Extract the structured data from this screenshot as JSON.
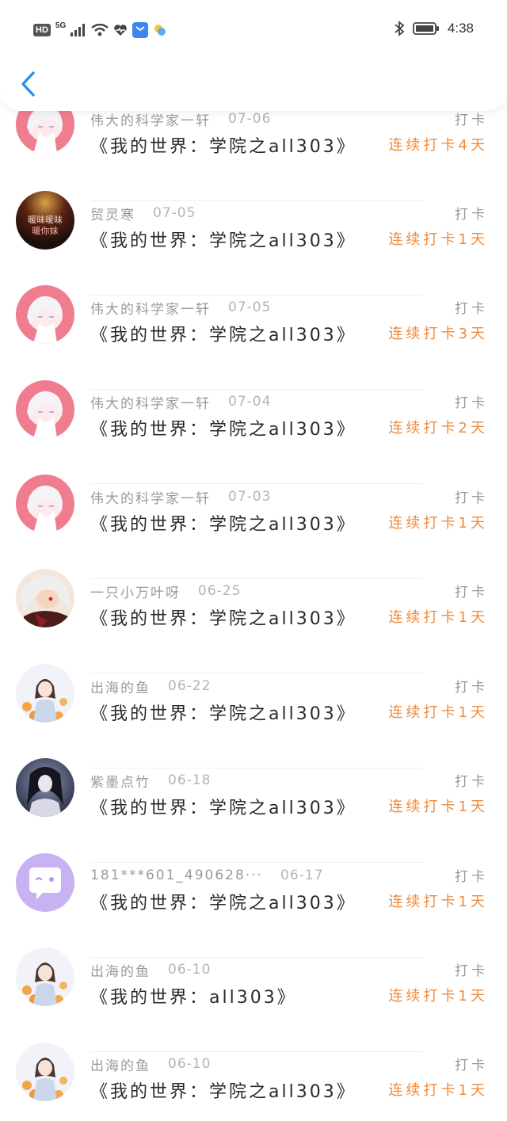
{
  "status_bar": {
    "hd": "HD",
    "network": "5G",
    "time": "4:38",
    "colors": {
      "mail": "#3d85f0"
    }
  },
  "nav": {
    "back_icon": "chevron-left-icon",
    "accent": "#2e8ef0"
  },
  "entries": [
    {
      "user": "伟大的科学家一轩",
      "date": "07-06",
      "title": "《我的世界：学院之all303》",
      "kind": "打卡",
      "streak": "连续打卡4天",
      "avatar": "white-hair"
    },
    {
      "user": "贸灵寒",
      "date": "07-05",
      "title": "《我的世界：学院之all303》",
      "kind": "打卡",
      "streak": "连续打卡1天",
      "avatar": "dark-text",
      "avatar_text": [
        "暖昧暖昧",
        "暖你妹"
      ]
    },
    {
      "user": "伟大的科学家一轩",
      "date": "07-05",
      "title": "《我的世界：学院之all303》",
      "kind": "打卡",
      "streak": "连续打卡3天",
      "avatar": "white-hair"
    },
    {
      "user": "伟大的科学家一轩",
      "date": "07-04",
      "title": "《我的世界：学院之all303》",
      "kind": "打卡",
      "streak": "连续打卡2天",
      "avatar": "white-hair"
    },
    {
      "user": "伟大的科学家一轩",
      "date": "07-03",
      "title": "《我的世界：学院之all303》",
      "kind": "打卡",
      "streak": "连续打卡1天",
      "avatar": "white-hair"
    },
    {
      "user": "一只小万叶呀",
      "date": "06-25",
      "title": "《我的世界：学院之all303》",
      "kind": "打卡",
      "streak": "连续打卡1天",
      "avatar": "redeye"
    },
    {
      "user": "出海的鱼",
      "date": "06-22",
      "title": "《我的世界：学院之all303》",
      "kind": "打卡",
      "streak": "连续打卡1天",
      "avatar": "girl"
    },
    {
      "user": "紫墨点竹",
      "date": "06-18",
      "title": "《我的世界：学院之all303》",
      "kind": "打卡",
      "streak": "连续打卡1天",
      "avatar": "dark"
    },
    {
      "user": "181***601_490628···",
      "date": "06-17",
      "title": "《我的世界：学院之all303》",
      "kind": "打卡",
      "streak": "连续打卡1天",
      "avatar": "default"
    },
    {
      "user": "出海的鱼",
      "date": "06-10",
      "title": "《我的世界：all303》",
      "kind": "打卡",
      "streak": "连续打卡1天",
      "avatar": "girl"
    },
    {
      "user": "出海的鱼",
      "date": "06-10",
      "title": "《我的世界：学院之all303》",
      "kind": "打卡",
      "streak": "连续打卡1天",
      "avatar": "girl"
    }
  ],
  "colors": {
    "streak": "#ef8b3c",
    "meta": "#9a9a9a",
    "title": "#2a2a2a"
  }
}
